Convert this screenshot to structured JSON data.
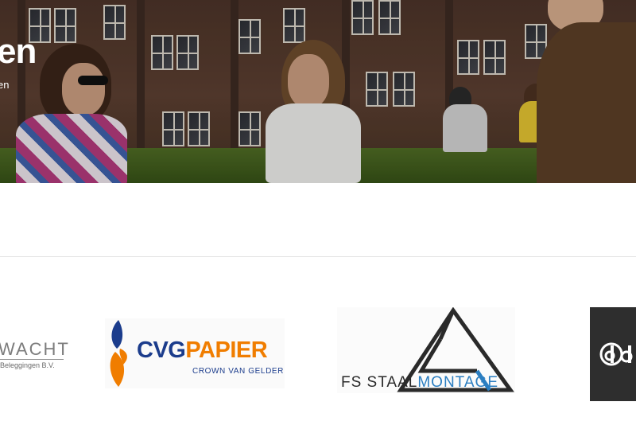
{
  "hero": {
    "title": "en",
    "subtitle": "en"
  },
  "logos": {
    "wacht": {
      "name": "WACHT",
      "tagline": "Beleggingen B.V."
    },
    "cvg": {
      "name_part1": "CVG",
      "name_part2": "PAPIER",
      "tagline": "CROWN VAN GELDER"
    },
    "fs": {
      "name_part1": "FS STAAL",
      "name_part2": "MONTAGE"
    },
    "dark": {
      "icon": "letter-d-logo-icon"
    }
  },
  "colors": {
    "cvg_blue": "#1b3c8c",
    "cvg_orange": "#f07d00",
    "fs_blue": "#2b7ec1",
    "divider": "#e3e3e3",
    "dark_tile": "#2e2e2e"
  }
}
